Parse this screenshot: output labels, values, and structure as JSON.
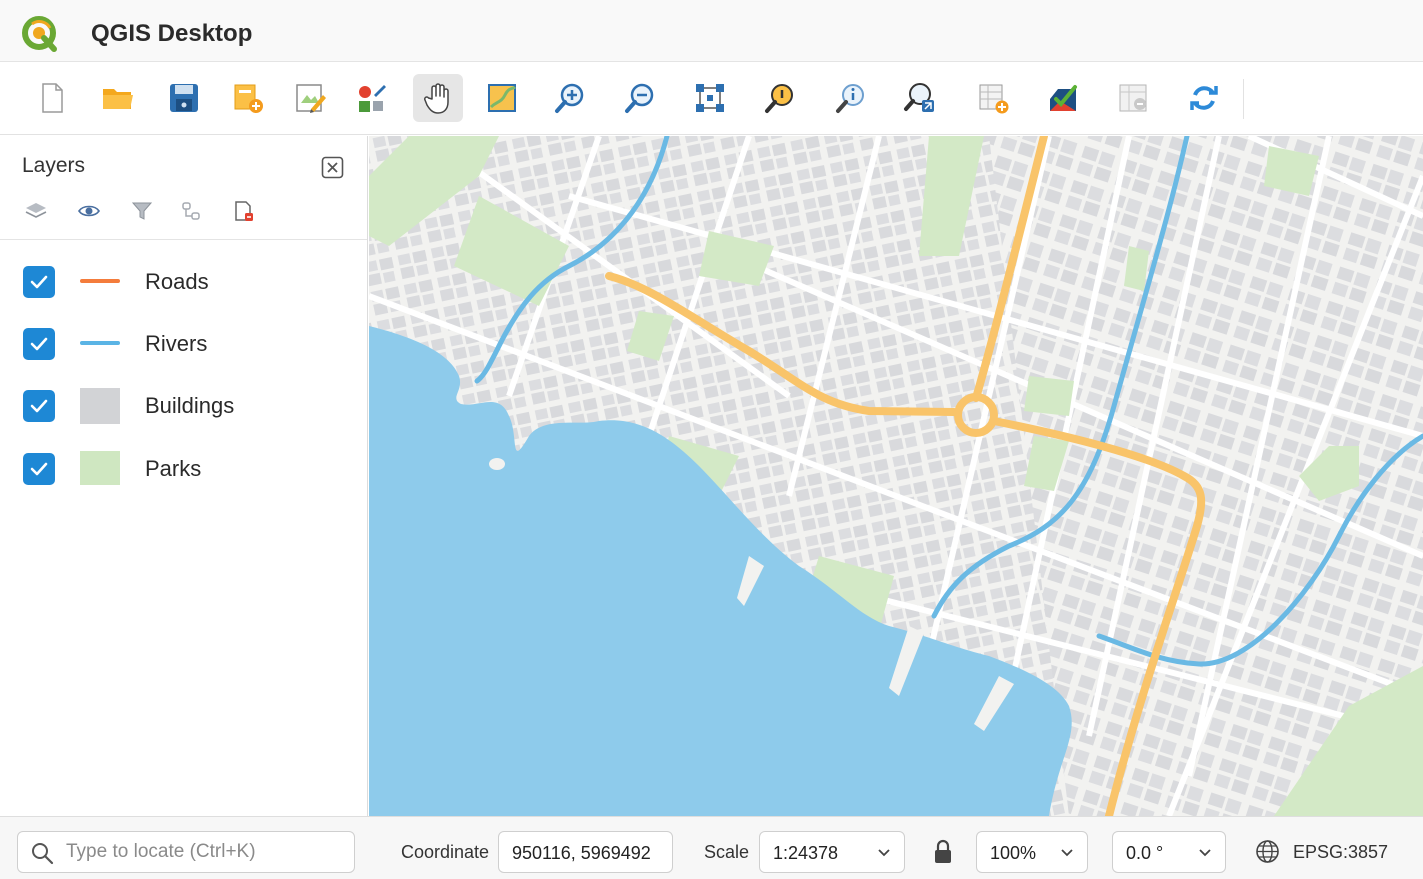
{
  "app": {
    "title": "QGIS Desktop"
  },
  "toolbar": {
    "tools": [
      {
        "name": "new-project",
        "icon": "new-file-icon"
      },
      {
        "name": "open-project",
        "icon": "folder-icon"
      },
      {
        "name": "save-project",
        "icon": "save-icon"
      },
      {
        "name": "new-layer",
        "icon": "new-layer-icon"
      },
      {
        "name": "print-layout",
        "icon": "layout-edit-icon"
      },
      {
        "name": "style-manager",
        "icon": "style-icon"
      },
      {
        "name": "pan",
        "icon": "hand-icon",
        "active": true
      },
      {
        "name": "zoom-full",
        "icon": "map-extent-icon"
      },
      {
        "name": "zoom-in",
        "icon": "zoom-in-icon"
      },
      {
        "name": "zoom-out",
        "icon": "zoom-out-icon"
      },
      {
        "name": "select-features",
        "icon": "vertex-select-icon"
      },
      {
        "name": "identify",
        "icon": "identify-icon"
      },
      {
        "name": "info",
        "icon": "info-magnifier-icon"
      },
      {
        "name": "measure",
        "icon": "measure-icon"
      },
      {
        "name": "add-annotation",
        "icon": "add-table-icon"
      },
      {
        "name": "edit-style",
        "icon": "check-brush-icon"
      },
      {
        "name": "attribute-table",
        "icon": "table-icon"
      },
      {
        "name": "refresh",
        "icon": "refresh-icon"
      }
    ]
  },
  "layers_panel": {
    "title": "Layers",
    "tools": [
      "layers-icon",
      "eye-icon",
      "filter-icon",
      "group-icon",
      "remove-layer-icon"
    ],
    "layers": [
      {
        "name": "Roads",
        "checked": true,
        "symbol": "line",
        "color": "#f47c3c"
      },
      {
        "name": "Rivers",
        "checked": true,
        "symbol": "line",
        "color": "#5ab4e5"
      },
      {
        "name": "Buildings",
        "checked": true,
        "symbol": "fill",
        "color": "#d2d3d6"
      },
      {
        "name": "Parks",
        "checked": true,
        "symbol": "fill",
        "color": "#cfe7c1"
      }
    ]
  },
  "colors": {
    "water": "#8ecbeb",
    "land": "#f2f2f0",
    "building": "#dadbdd",
    "park": "#d3e9c6",
    "road_major": "#f9c46a",
    "river": "#6ab9e4",
    "accent": "#1e88d5"
  },
  "statusbar": {
    "locate_placeholder": "Type to locate (Ctrl+K)",
    "coordinate_label": "Coordinate",
    "coordinate_value": "950116, 5969492",
    "scale_label": "Scale",
    "scale_value": "1:24378",
    "magnifier_value": "100%",
    "rotation_value": "0.0 °",
    "crs_value": "EPSG:3857"
  }
}
